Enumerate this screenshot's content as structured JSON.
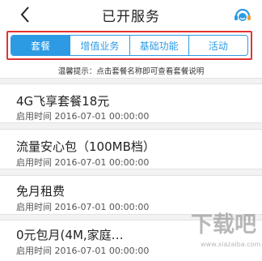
{
  "header": {
    "title": "已开服务",
    "back_icon": "back-arrow-icon",
    "service_icon": "customer-service-icon"
  },
  "colors": {
    "accent": "#2d9be4",
    "highlight_border": "#e23333"
  },
  "tabs": [
    {
      "label": "套餐",
      "active": true
    },
    {
      "label": "增值业务",
      "active": false
    },
    {
      "label": "基础功能",
      "active": false
    },
    {
      "label": "活动",
      "active": false
    }
  ],
  "tip": "温馨提示：点击套餐名称即可查看套餐说明",
  "services": [
    {
      "name": "4G飞享套餐18元",
      "date": "启用时间  2016-07-01  00:00:00"
    },
    {
      "name": "流量安心包（100MB档）",
      "date": "启用时间  2016-07-01  00:00:00"
    },
    {
      "name": "免月租费",
      "date": "启用时间  2016-07-01  00:00:00"
    },
    {
      "name": "0元包月(4M,家庭…",
      "date": "启用时间  2016-07-01  00:00:00"
    }
  ],
  "watermark": {
    "text": "下载吧",
    "url": "www.xiazaiba.com"
  }
}
